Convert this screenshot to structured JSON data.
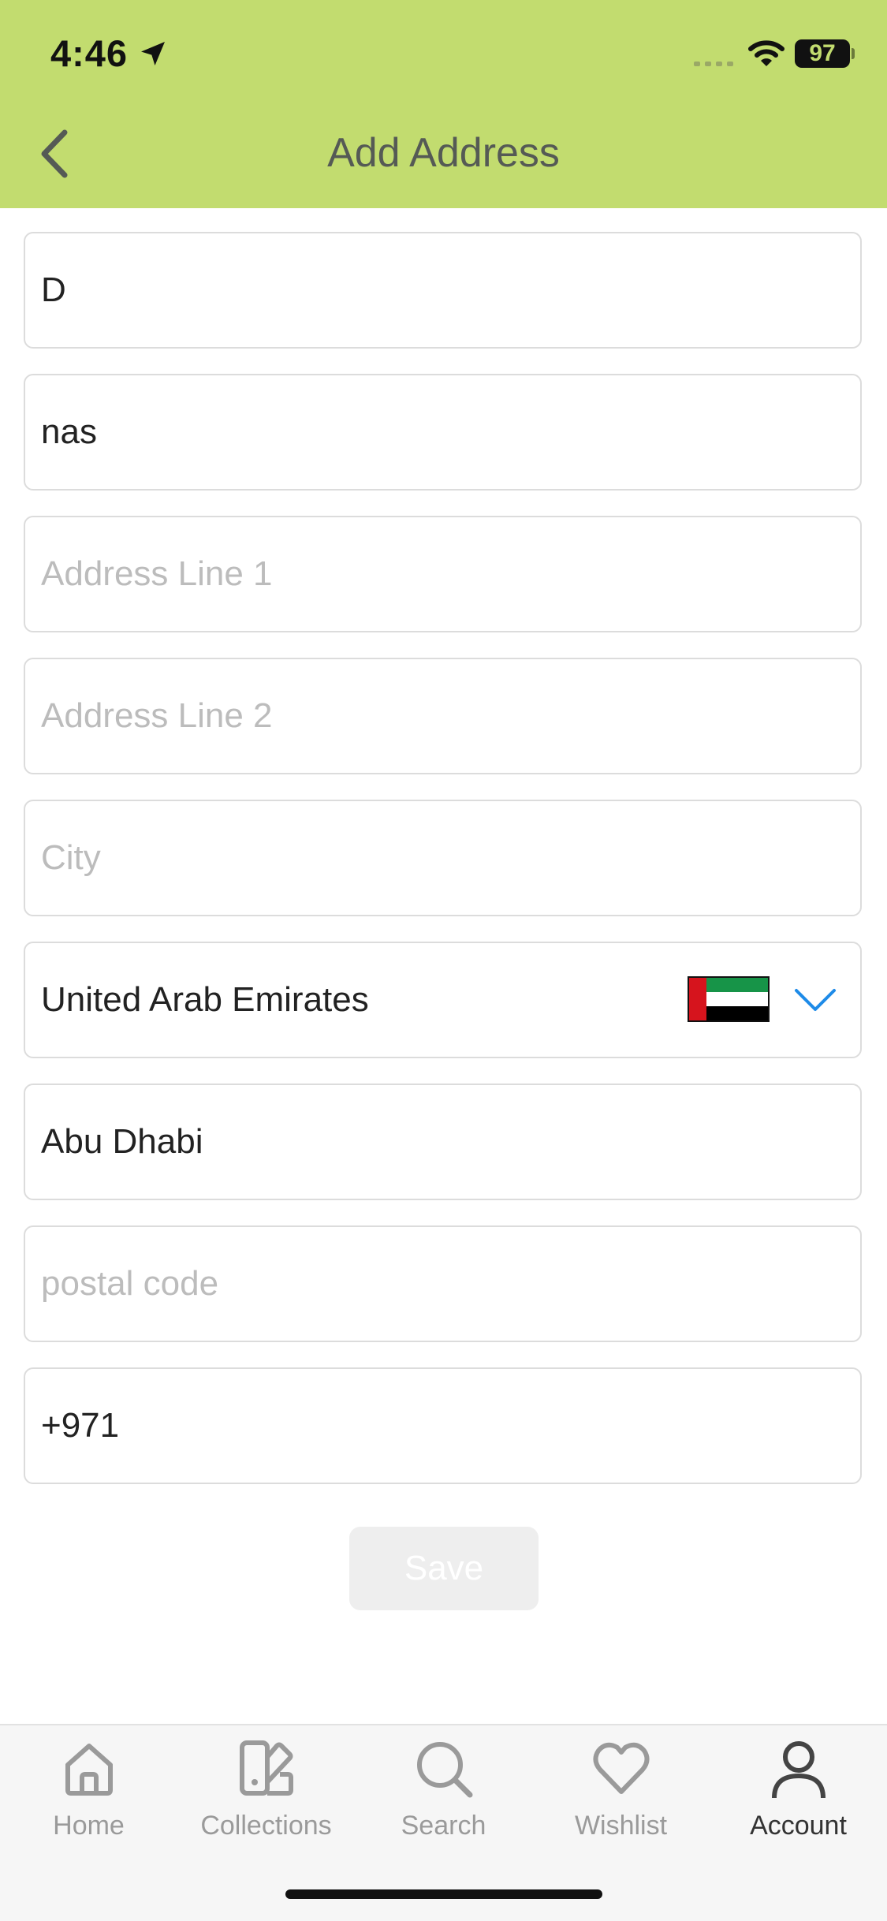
{
  "status_bar": {
    "time": "4:46",
    "battery": "97"
  },
  "header": {
    "title": "Add Address",
    "back_icon": "chevron-left-icon"
  },
  "form": {
    "first_name": {
      "value": "D",
      "placeholder": ""
    },
    "last_name": {
      "value": "nas",
      "placeholder": ""
    },
    "address_line_1": {
      "value": "",
      "placeholder": "Address Line 1"
    },
    "address_line_2": {
      "value": "",
      "placeholder": "Address Line 2"
    },
    "city": {
      "value": "",
      "placeholder": "City"
    },
    "country": {
      "value": "United Arab Emirates",
      "flag_icon": "uae-flag-icon"
    },
    "province": {
      "value": "Abu Dhabi",
      "placeholder": ""
    },
    "postal_code": {
      "value": "",
      "placeholder": "postal code"
    },
    "phone": {
      "value": "+971",
      "placeholder": ""
    },
    "save_label": "Save"
  },
  "tabbar": {
    "items": [
      {
        "label": "Home",
        "icon": "home-icon"
      },
      {
        "label": "Collections",
        "icon": "collections-icon"
      },
      {
        "label": "Search",
        "icon": "search-icon"
      },
      {
        "label": "Wishlist",
        "icon": "heart-icon"
      },
      {
        "label": "Account",
        "icon": "account-icon",
        "active": true
      }
    ]
  },
  "colors": {
    "header_bg": "#c2dc6f",
    "chevron_accent": "#1e8be8"
  }
}
